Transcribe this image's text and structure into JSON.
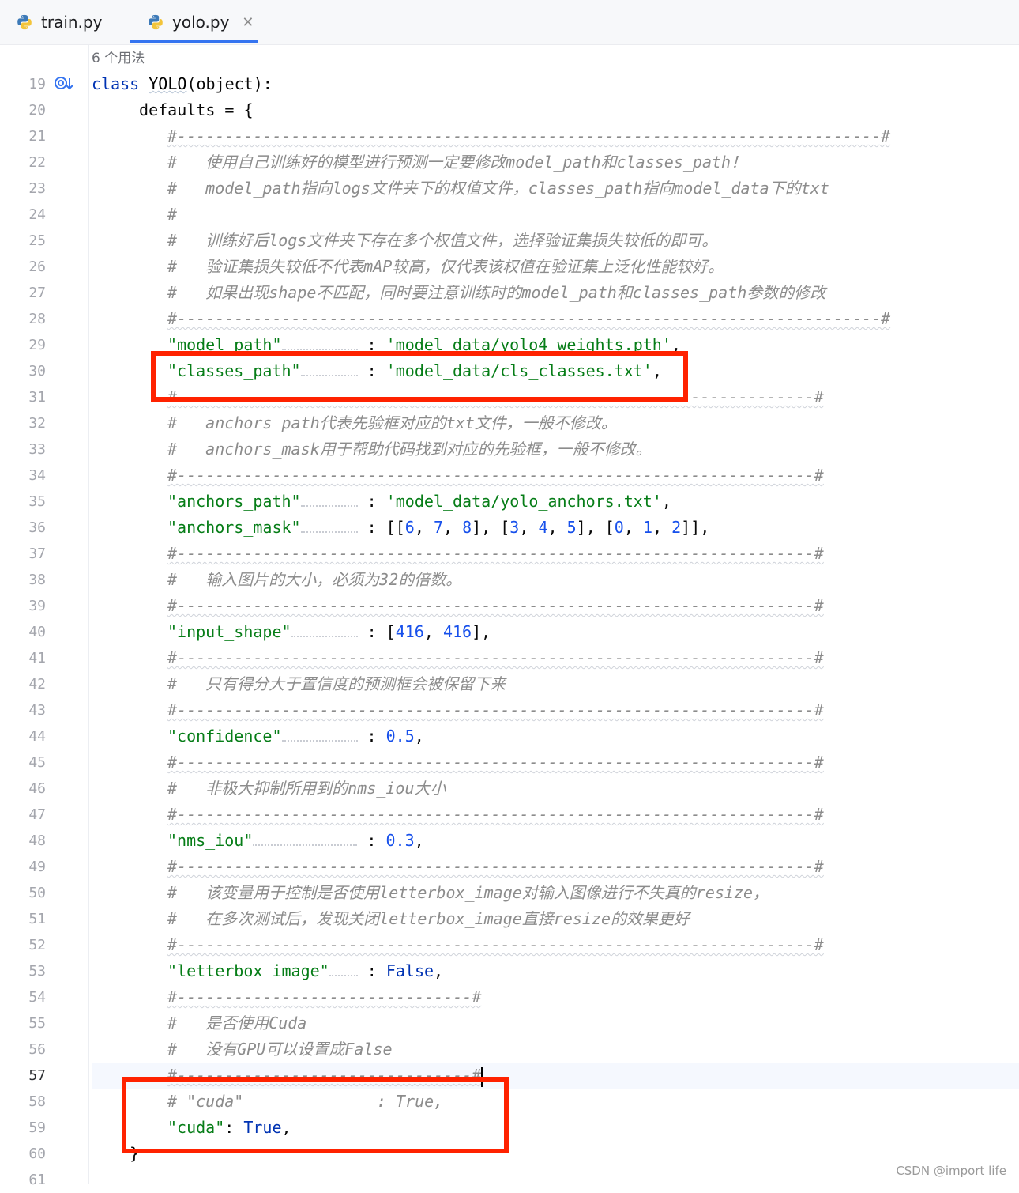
{
  "tabs": [
    {
      "label": "train.py",
      "active": false
    },
    {
      "label": "yolo.py",
      "active": true
    }
  ],
  "editor": {
    "usage_hint": "6 个用法",
    "current_line": 57,
    "line_numbers": [
      "19",
      "20",
      "21",
      "22",
      "23",
      "24",
      "25",
      "26",
      "27",
      "28",
      "29",
      "30",
      "31",
      "32",
      "33",
      "34",
      "35",
      "36",
      "37",
      "38",
      "39",
      "40",
      "41",
      "42",
      "43",
      "44",
      "45",
      "46",
      "47",
      "48",
      "49",
      "50",
      "51",
      "52",
      "53",
      "54",
      "55",
      "56",
      "57",
      "58",
      "59",
      "60",
      "61"
    ],
    "lines": {
      "l19": {
        "kw": "class",
        "name": "YOLO",
        "rest": "(object):"
      },
      "l20": "_defaults = {",
      "l21": "#--------------------------------------------------------------------------#",
      "l22": "#   使用自己训练好的模型进行预测一定要修改model_path和classes_path！",
      "l23": "#   model_path指向logs文件夹下的权值文件，classes_path指向model_data下的txt",
      "l24": "#",
      "l25": "#   训练好后logs文件夹下存在多个权值文件，选择验证集损失较低的即可。",
      "l26": "#   验证集损失较低不代表mAP较高，仅代表该权值在验证集上泛化性能较好。",
      "l27": "#   如果出现shape不匹配，同时要注意训练时的model_path和classes_path参数的修改",
      "l28": "#--------------------------------------------------------------------------#",
      "l29": {
        "key": "\"model_path\"",
        "value": "'model_data/yolo4_weights.pth'"
      },
      "l30": {
        "key": "\"classes_path\"",
        "value": "'model_data/cls_classes.txt'"
      },
      "l31": "#-------------------------------------------------------------------#",
      "l32": "#   anchors_path代表先验框对应的txt文件，一般不修改。",
      "l33": "#   anchors_mask用于帮助代码找到对应的先验框，一般不修改。",
      "l34": "#-------------------------------------------------------------------#",
      "l35": {
        "key": "\"anchors_path\"",
        "value": "'model_data/yolo_anchors.txt'"
      },
      "l36": {
        "key": "\"anchors_mask\"",
        "nums": [
          "6",
          "7",
          "8",
          "3",
          "4",
          "5",
          "0",
          "1",
          "2"
        ]
      },
      "l37": "#-------------------------------------------------------------------#",
      "l38": "#   输入图片的大小，必须为32的倍数。",
      "l39": "#-------------------------------------------------------------------#",
      "l40": {
        "key": "\"input_shape\"",
        "nums": [
          "416",
          "416"
        ]
      },
      "l41": "#-------------------------------------------------------------------#",
      "l42": "#   只有得分大于置信度的预测框会被保留下来",
      "l43": "#-------------------------------------------------------------------#",
      "l44": {
        "key": "\"confidence\"",
        "value": "0.5"
      },
      "l45": "#-------------------------------------------------------------------#",
      "l46": "#   非极大抑制所用到的nms_iou大小",
      "l47": "#-------------------------------------------------------------------#",
      "l48": {
        "key": "\"nms_iou\"",
        "value": "0.3"
      },
      "l49": "#-------------------------------------------------------------------#",
      "l50": "#   该变量用于控制是否使用letterbox_image对输入图像进行不失真的resize，",
      "l51": "#   在多次测试后，发现关闭letterbox_image直接resize的效果更好",
      "l52": "#-------------------------------------------------------------------#",
      "l53": {
        "key": "\"letterbox_image\"",
        "value": "False"
      },
      "l54": "#-------------------------------#",
      "l55": "#   是否使用Cuda",
      "l56": "#   没有GPU可以设置成False",
      "l57": "#-------------------------------#",
      "l58": "# \"cuda\"              : True,",
      "l59": {
        "key": "\"cuda\"",
        "value": "True"
      },
      "l60": "}"
    }
  },
  "watermark": "CSDN @import life",
  "colors": {
    "keyword": "#0033b3",
    "string": "#067d17",
    "number": "#1750eb",
    "comment": "#8c8c8c",
    "annotation_box": "#ff2200",
    "tab_underline": "#3574f0"
  }
}
